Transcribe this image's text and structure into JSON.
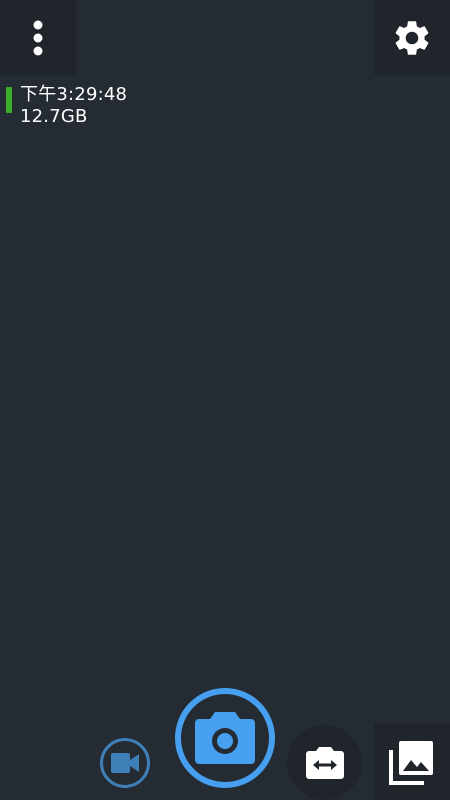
{
  "status": {
    "time": "下午3:29:48",
    "storage": "12.7GB",
    "battery_color": "#3dae2b"
  },
  "icons": {
    "menu": "more-vert-icon",
    "settings": "gear-icon",
    "video": "video-camera-icon",
    "shutter": "camera-icon",
    "switch_camera": "switch-camera-icon",
    "gallery": "gallery-icon"
  },
  "colors": {
    "background": "#252b33",
    "accent": "#46a0ef",
    "video_accent": "#3f7fb8"
  }
}
